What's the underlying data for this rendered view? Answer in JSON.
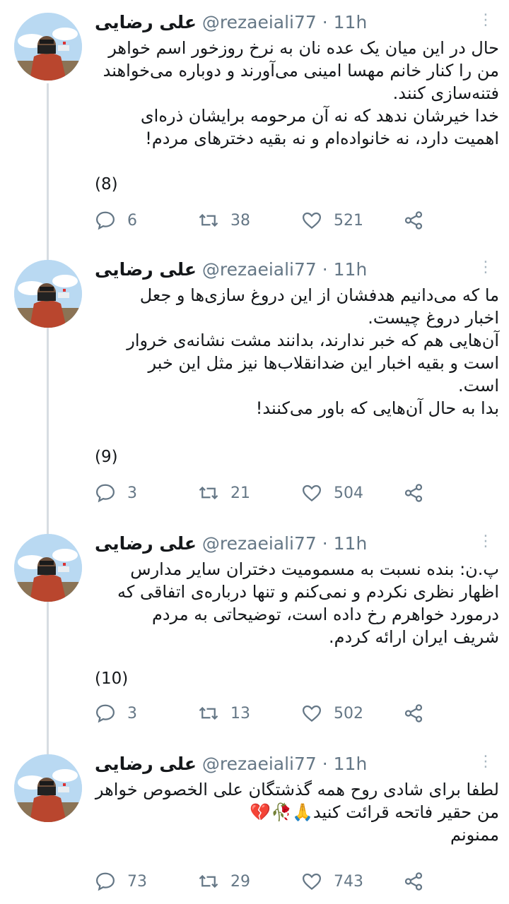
{
  "author": {
    "name": "علی رضایی",
    "handle": "@rezaeiali77",
    "time": "11h"
  },
  "tweets": [
    {
      "lines": [
        "حال در این میان یک عده نان به نرخ روزخور اسم خواهر",
        "من را کنار خانم مهسا امینی می‌آورند و دوباره می‌خواهند",
        "فتنه‌سازی کنند.",
        "خدا خیرشان ندهد که نه آن مرحومه برایشان ذره‌ای",
        "اهمیت دارد، نه خانواده‌ام و نه بقیه دخترهای مردم!"
      ],
      "counter": "(8)",
      "replies": "6",
      "retweets": "38",
      "likes": "521"
    },
    {
      "lines": [
        "ما که می‌دانیم هدفشان از این دروغ سازی‌ها و جعل",
        "اخبار دروغ چیست.",
        "آن‌هایی هم که خبر ندارند، بدانند مشت نشانه‌ی خروار",
        "است و بقیه اخبار این ضدانقلاب‌ها نیز مثل این خبر",
        "است.",
        "بدا به حال آن‌هایی که باور می‌کنند!"
      ],
      "counter": "(9)",
      "replies": "3",
      "retweets": "21",
      "likes": "504"
    },
    {
      "lines": [
        "پ.ن: بنده نسبت به مسمومیت دختران سایر مدارس",
        "اظهار نظری نکردم و نمی‌کنم و تنها درباره‌ی اتفاقی که",
        "درمورد خواهرم رخ داده است، توضیحاتی به مردم",
        "شریف ایران ارائه کردم."
      ],
      "counter": "(10)",
      "replies": "3",
      "retweets": "13",
      "likes": "502"
    },
    {
      "lines": [
        "لطفا برای شادی روح همه گذشتگان علی الخصوص خواهر",
        "من حقیر فاتحه قرائت کنید🙏🥀💔",
        "ممنونم"
      ],
      "counter": "",
      "replies": "73",
      "retweets": "29",
      "likes": "743"
    }
  ],
  "icons": {
    "reply": "reply-icon",
    "retweet": "retweet-icon",
    "like": "heart-icon",
    "share": "share-icon",
    "more": "more-vertical-icon"
  },
  "colors": {
    "text": "#14171a",
    "muted": "#657786",
    "thread_line": "#d7dde2"
  }
}
